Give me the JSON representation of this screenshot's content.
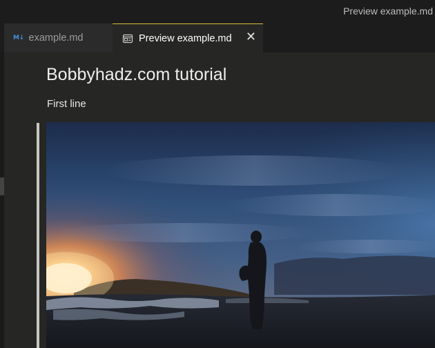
{
  "window": {
    "title": "Preview example.md"
  },
  "tabs": [
    {
      "label": "example.md",
      "icon": "markdown-icon",
      "active": false
    },
    {
      "label": "Preview example.md",
      "icon": "preview-icon",
      "active": true,
      "close_icon": "close-icon",
      "close_glyph": "✕"
    }
  ],
  "markdown_icon_glyph": "M↓",
  "preview": {
    "heading": "Bobbyhadz.com tutorial",
    "paragraph": "First line",
    "image": {
      "description": "silhouette-at-dusk"
    }
  },
  "colors": {
    "accent_tab_border": "#d8c23a",
    "markdown_icon": "#4a8fd8",
    "editor_bg": "#262624"
  }
}
